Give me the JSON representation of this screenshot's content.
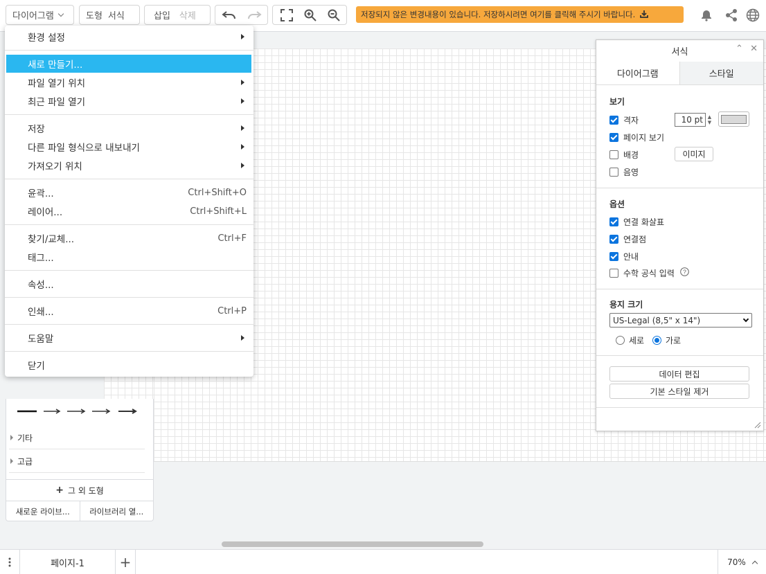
{
  "toolbar": {
    "diagram_menu": "다이어그램",
    "shapes_menu": "도형",
    "format_menu": "서식",
    "insert_menu": "삽입",
    "delete_menu": "삭제",
    "unsaved_notice": "저장되지 않은 변경내용이 있습니다. 저장하시려면 여기를 클릭해 주시기 바랍니다.",
    "icons": [
      "undo-icon",
      "redo-icon",
      "fullscreen-icon",
      "zoom-in-icon",
      "zoom-out-icon",
      "download-icon",
      "bell-icon",
      "share-icon",
      "globe-icon"
    ]
  },
  "file_menu": {
    "items": [
      {
        "label": "환경 설정",
        "shortcut": "",
        "submenu": true
      },
      {
        "label": "새로 만들기...",
        "shortcut": "",
        "submenu": false,
        "highlighted": true
      },
      {
        "label": "파일 열기 위치",
        "shortcut": "",
        "submenu": true
      },
      {
        "label": "최근 파일 열기",
        "shortcut": "",
        "submenu": true
      },
      {
        "label": "저장",
        "shortcut": "",
        "submenu": true
      },
      {
        "label": "다른 파일 형식으로 내보내기",
        "shortcut": "",
        "submenu": true
      },
      {
        "label": "가져오기 위치",
        "shortcut": "",
        "submenu": true
      },
      {
        "label": "윤곽...",
        "shortcut": "Ctrl+Shift+O",
        "submenu": false
      },
      {
        "label": "레이어...",
        "shortcut": "Ctrl+Shift+L",
        "submenu": false
      },
      {
        "label": "찾기/교체...",
        "shortcut": "Ctrl+F",
        "submenu": false
      },
      {
        "label": "태그...",
        "shortcut": "",
        "submenu": false
      },
      {
        "label": "속성...",
        "shortcut": "",
        "submenu": false
      },
      {
        "label": "인쇄...",
        "shortcut": "Ctrl+P",
        "submenu": false
      },
      {
        "label": "도움말",
        "shortcut": "",
        "submenu": true
      },
      {
        "label": "닫기",
        "shortcut": "",
        "submenu": false
      }
    ]
  },
  "shapes_panel": {
    "sections": [
      "기타",
      "고급"
    ],
    "more_shapes": "그 외 도형",
    "new_library": "새로운 라이브...",
    "open_library": "라이브러리 열..."
  },
  "format_panel": {
    "title": "서식",
    "tabs": [
      "다이어그램",
      "스타일"
    ],
    "view_title": "보기",
    "grid_label": "격자",
    "grid_size": "10 pt",
    "page_view_label": "페이지 보기",
    "background_label": "배경",
    "image_button": "이미지",
    "shadow_label": "음영",
    "options_title": "옵션",
    "connection_arrows_label": "연결 화살표",
    "connection_points_label": "연결점",
    "guides_label": "안내",
    "math_label": "수학 공식 입력",
    "paper_title": "용지 크기",
    "paper_size": "US-Legal (8,5\" x 14\")",
    "portrait_label": "세로",
    "landscape_label": "가로",
    "edit_data_button": "데이터 편집",
    "clear_style_button": "기본 스타일 제거",
    "checks": {
      "grid": true,
      "page_view": true,
      "background": false,
      "shadow": false,
      "connection_arrows": true,
      "connection_points": true,
      "guides": true,
      "math": false
    },
    "orientation": "landscape"
  },
  "bottombar": {
    "page_tab": "페이지-1",
    "zoom": "70%"
  },
  "colors": {
    "highlight": "#2ab7f0",
    "notice": "#f7a83c",
    "checkbox": "#0b74de"
  }
}
